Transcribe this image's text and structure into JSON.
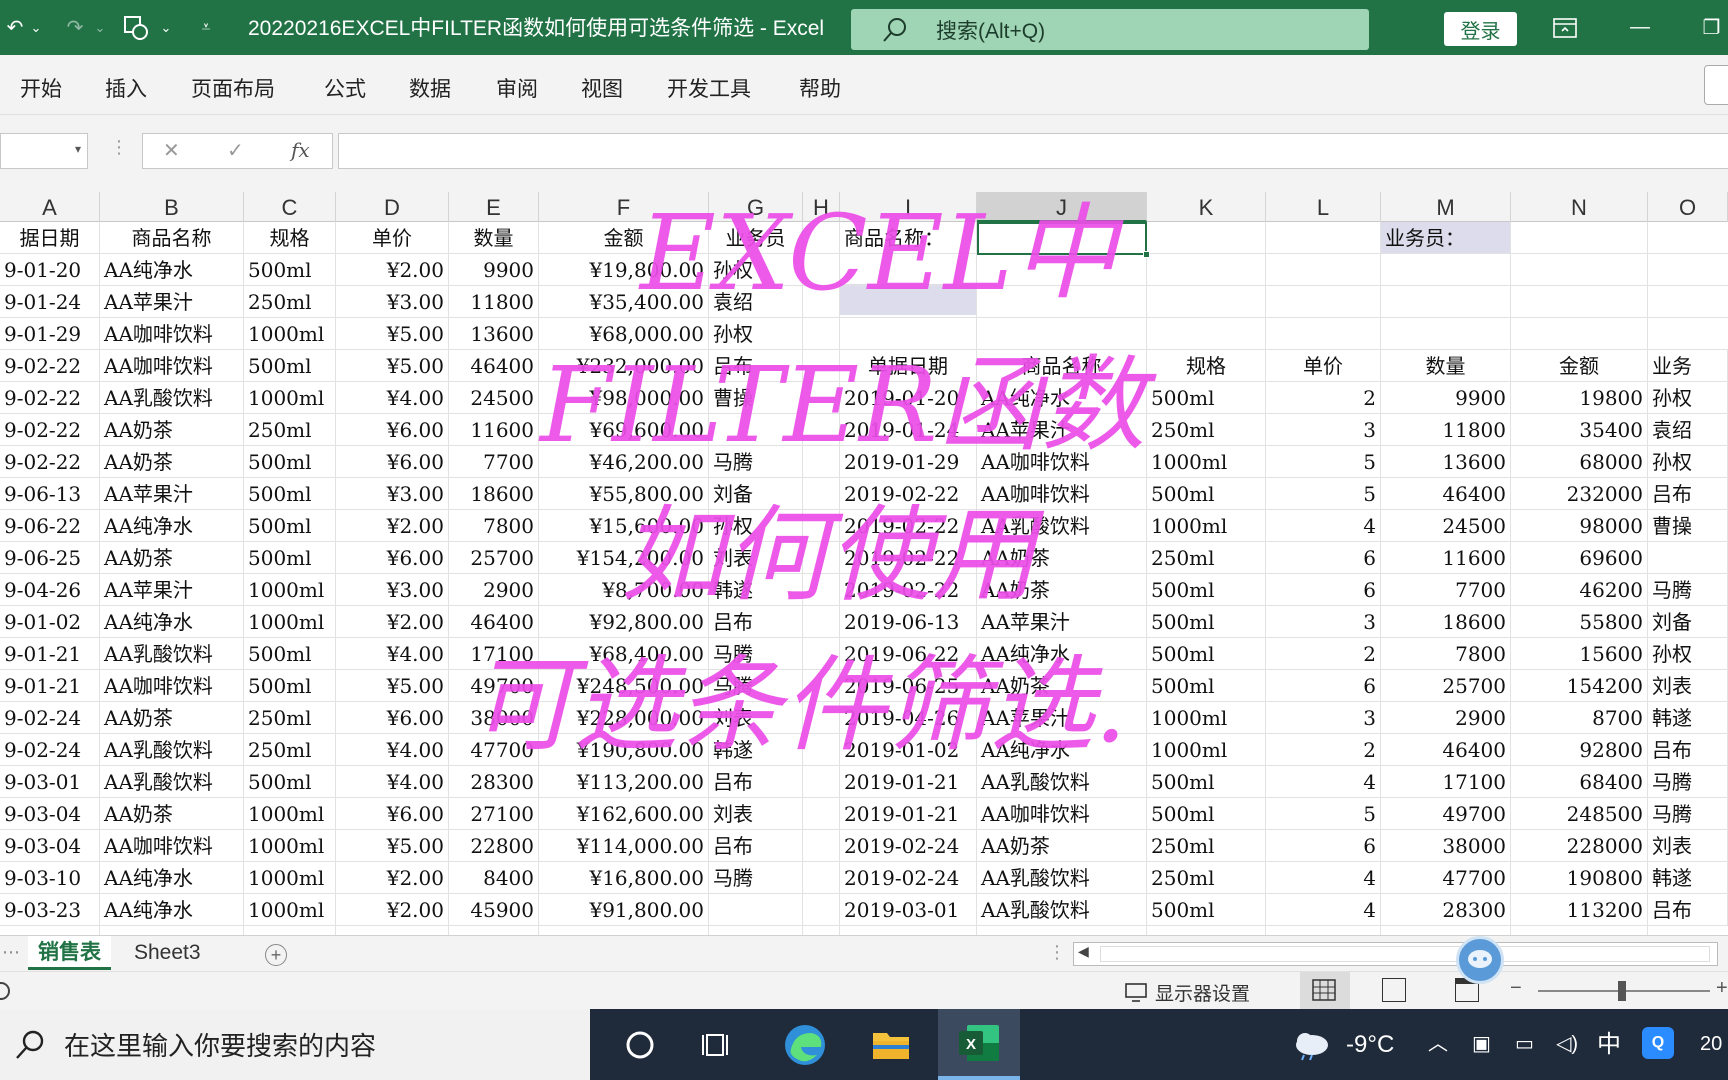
{
  "titlebar": {
    "doc_title": "20220216EXCEL中FILTER函数如何使用可选条件筛选  -  Excel",
    "search_placeholder": "搜索(Alt+Q)",
    "login_label": "登录"
  },
  "ribbon": {
    "tabs": [
      "开始",
      "插入",
      "页面布局",
      "公式",
      "数据",
      "审阅",
      "视图",
      "开发工具",
      "帮助"
    ]
  },
  "formula": {
    "fx_label": "fx",
    "cancel": "✕",
    "confirm": "✓"
  },
  "columns": [
    "A",
    "B",
    "C",
    "D",
    "E",
    "F",
    "G",
    "H",
    "I",
    "J",
    "K",
    "L",
    "M",
    "N",
    "O"
  ],
  "header_row": {
    "a": "据日期",
    "b": "商品名称",
    "c": "规格",
    "d": "单价",
    "e": "数量",
    "f": "金额",
    "g": "业务员",
    "i": "商品名称：",
    "m": "业务员："
  },
  "right_header": {
    "i": "单据日期",
    "j": "商品名称",
    "k": "规格",
    "l": "单价",
    "m": "数量",
    "n": "金额",
    "o": "业务"
  },
  "left_rows": [
    [
      "9-01-20",
      "AA纯净水",
      "500ml",
      "¥2.00",
      "9900",
      "¥19,800.00",
      "孙权"
    ],
    [
      "9-01-24",
      "AA苹果汁",
      "250ml",
      "¥3.00",
      "11800",
      "¥35,400.00",
      "袁绍"
    ],
    [
      "9-01-29",
      "AA咖啡饮料",
      "1000ml",
      "¥5.00",
      "13600",
      "¥68,000.00",
      "孙权"
    ],
    [
      "9-02-22",
      "AA咖啡饮料",
      "500ml",
      "¥5.00",
      "46400",
      "¥232,000.00",
      "吕布"
    ],
    [
      "9-02-22",
      "AA乳酸饮料",
      "1000ml",
      "¥4.00",
      "24500",
      "¥98,000.00",
      "曹操"
    ],
    [
      "9-02-22",
      "AA奶茶",
      "250ml",
      "¥6.00",
      "11600",
      "¥69,600.00",
      ""
    ],
    [
      "9-02-22",
      "AA奶茶",
      "500ml",
      "¥6.00",
      "7700",
      "¥46,200.00",
      "马腾"
    ],
    [
      "9-06-13",
      "AA苹果汁",
      "500ml",
      "¥3.00",
      "18600",
      "¥55,800.00",
      "刘备"
    ],
    [
      "9-06-22",
      "AA纯净水",
      "500ml",
      "¥2.00",
      "7800",
      "¥15,600.00",
      "孙权"
    ],
    [
      "9-06-25",
      "AA奶茶",
      "500ml",
      "¥6.00",
      "25700",
      "¥154,200.00",
      "刘表"
    ],
    [
      "9-04-26",
      "AA苹果汁",
      "1000ml",
      "¥3.00",
      "2900",
      "¥8,700.00",
      "韩遂"
    ],
    [
      "9-01-02",
      "AA纯净水",
      "1000ml",
      "¥2.00",
      "46400",
      "¥92,800.00",
      "吕布"
    ],
    [
      "9-01-21",
      "AA乳酸饮料",
      "500ml",
      "¥4.00",
      "17100",
      "¥68,400.00",
      "马腾"
    ],
    [
      "9-01-21",
      "AA咖啡饮料",
      "500ml",
      "¥5.00",
      "49700",
      "¥248,500.00",
      "马腾"
    ],
    [
      "9-02-24",
      "AA奶茶",
      "250ml",
      "¥6.00",
      "38000",
      "¥228,000.00",
      "刘表"
    ],
    [
      "9-02-24",
      "AA乳酸饮料",
      "250ml",
      "¥4.00",
      "47700",
      "¥190,800.00",
      "韩遂"
    ],
    [
      "9-03-01",
      "AA乳酸饮料",
      "500ml",
      "¥4.00",
      "28300",
      "¥113,200.00",
      "吕布"
    ],
    [
      "9-03-04",
      "AA奶茶",
      "1000ml",
      "¥6.00",
      "27100",
      "¥162,600.00",
      "刘表"
    ],
    [
      "9-03-04",
      "AA咖啡饮料",
      "1000ml",
      "¥5.00",
      "22800",
      "¥114,000.00",
      "吕布"
    ],
    [
      "9-03-10",
      "AA纯净水",
      "1000ml",
      "¥2.00",
      "8400",
      "¥16,800.00",
      "马腾"
    ],
    [
      "9-03-23",
      "AA纯净水",
      "1000ml",
      "¥2.00",
      "45900",
      "¥91,800.00",
      ""
    ]
  ],
  "right_rows": [
    [
      "2019-01-20",
      "AA纯净水",
      "500ml",
      "2",
      "9900",
      "19800",
      "孙权"
    ],
    [
      "2019-01-24",
      "AA苹果汁",
      "250ml",
      "3",
      "11800",
      "35400",
      "袁绍"
    ],
    [
      "2019-01-29",
      "AA咖啡饮料",
      "1000ml",
      "5",
      "13600",
      "68000",
      "孙权"
    ],
    [
      "2019-02-22",
      "AA咖啡饮料",
      "500ml",
      "5",
      "46400",
      "232000",
      "吕布"
    ],
    [
      "2019-02-22",
      "AA乳酸饮料",
      "1000ml",
      "4",
      "24500",
      "98000",
      "曹操"
    ],
    [
      "2019-02-22",
      "AA奶茶",
      "250ml",
      "6",
      "11600",
      "69600",
      ""
    ],
    [
      "2019-02-22",
      "AA奶茶",
      "500ml",
      "6",
      "7700",
      "46200",
      "马腾"
    ],
    [
      "2019-06-13",
      "AA苹果汁",
      "500ml",
      "3",
      "18600",
      "55800",
      "刘备"
    ],
    [
      "2019-06-22",
      "AA纯净水",
      "500ml",
      "2",
      "7800",
      "15600",
      "孙权"
    ],
    [
      "2019-06-25",
      "AA奶茶",
      "500ml",
      "6",
      "25700",
      "154200",
      "刘表"
    ],
    [
      "2019-04-26",
      "AA苹果汁",
      "1000ml",
      "3",
      "2900",
      "8700",
      "韩遂"
    ],
    [
      "2019-01-02",
      "AA纯净水",
      "1000ml",
      "2",
      "46400",
      "92800",
      "吕布"
    ],
    [
      "2019-01-21",
      "AA乳酸饮料",
      "500ml",
      "4",
      "17100",
      "68400",
      "马腾"
    ],
    [
      "2019-01-21",
      "AA咖啡饮料",
      "500ml",
      "5",
      "49700",
      "248500",
      "马腾"
    ],
    [
      "2019-02-24",
      "AA奶茶",
      "250ml",
      "6",
      "38000",
      "228000",
      "刘表"
    ],
    [
      "2019-02-24",
      "AA乳酸饮料",
      "250ml",
      "4",
      "47700",
      "190800",
      "韩遂"
    ],
    [
      "2019-03-01",
      "AA乳酸饮料",
      "500ml",
      "4",
      "28300",
      "113200",
      "吕布"
    ]
  ],
  "overlay": {
    "line1": "EXCEL中",
    "line2": "FILTER函数",
    "line3": "如何使用",
    "line4": "可选条件筛选."
  },
  "sheets": {
    "tab1": "销售表",
    "tab2": "Sheet3"
  },
  "status": {
    "display_settings": "显示器设置"
  },
  "taskbar": {
    "search_placeholder": "在这里输入你要搜索的内容",
    "temperature": "-9°C",
    "ime": "中",
    "clock": "20"
  },
  "colors": {
    "excel_green": "#217346",
    "overlay_magenta": "#ec4ee8",
    "taskbar": "#1f2a3a"
  }
}
